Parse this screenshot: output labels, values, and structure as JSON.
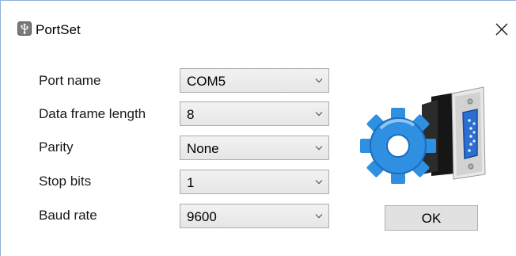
{
  "window": {
    "title": "PortSet",
    "app_icon": "usb-icon",
    "close_icon": "close-icon"
  },
  "form": {
    "fields": [
      {
        "label": "Port name",
        "value": "COM5"
      },
      {
        "label": "Data frame length",
        "value": "8"
      },
      {
        "label": "Parity",
        "value": "None"
      },
      {
        "label": "Stop bits",
        "value": "1"
      },
      {
        "label": "Baud rate",
        "value": "9600"
      }
    ],
    "dropdown_icon": "chevron-down-icon"
  },
  "actions": {
    "ok_label": "OK"
  },
  "illustration": {
    "icon": "gear-serial-port-icon"
  },
  "colors": {
    "window_border": "#8fb1d6",
    "gear_blue": "#2f8fe0",
    "connector_dark": "#1d1d1d",
    "port_blue": "#2b6fd1"
  }
}
